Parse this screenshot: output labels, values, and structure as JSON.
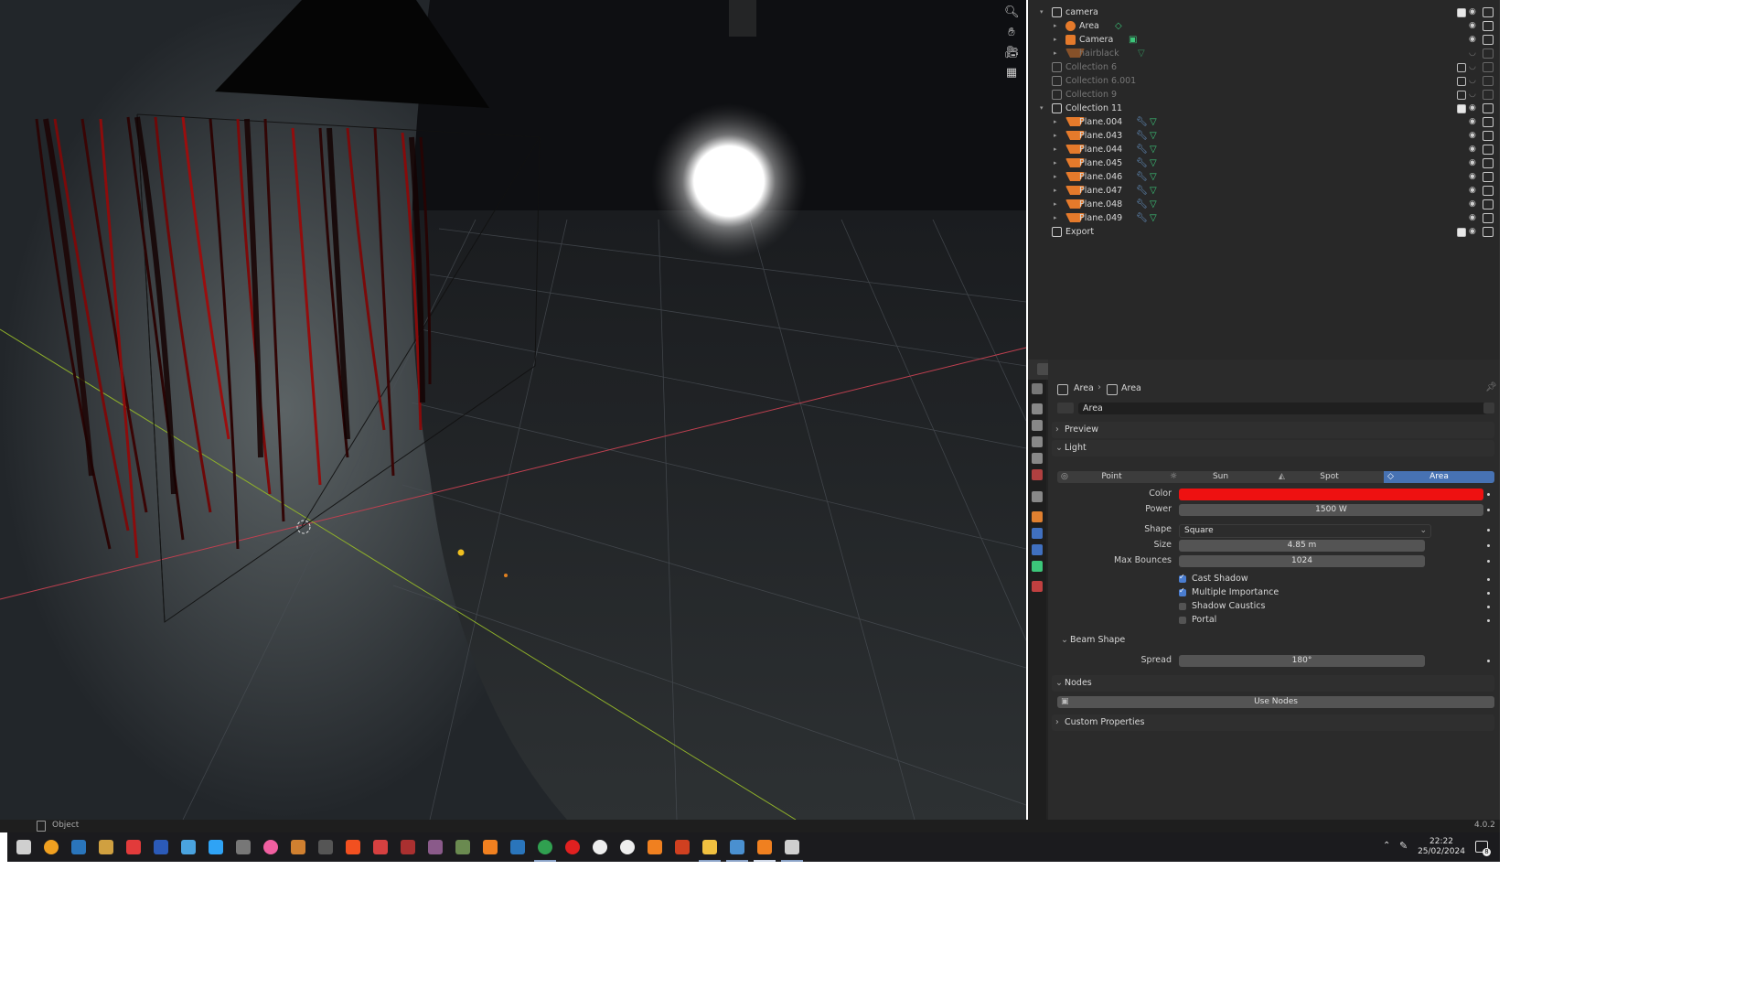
{
  "outliner": {
    "rows": [
      {
        "label": "camera",
        "kind": "collection",
        "dim": false,
        "expanded": true,
        "checked": true
      },
      {
        "label": "Area",
        "kind": "light",
        "dim": false
      },
      {
        "label": "Camera",
        "kind": "camera",
        "dim": false
      },
      {
        "label": "hairblack",
        "kind": "mesh",
        "dim": true
      },
      {
        "label": "Collection 6",
        "kind": "collection",
        "dim": true,
        "checked": false
      },
      {
        "label": "Collection 6.001",
        "kind": "collection",
        "dim": true,
        "checked": false
      },
      {
        "label": "Collection 9",
        "kind": "collection",
        "dim": true,
        "checked": false
      },
      {
        "label": "Collection 11",
        "kind": "collection",
        "dim": false,
        "expanded": true,
        "checked": true
      },
      {
        "label": "Plane.004",
        "kind": "mesh",
        "dim": false
      },
      {
        "label": "Plane.043",
        "kind": "mesh",
        "dim": false
      },
      {
        "label": "Plane.044",
        "kind": "mesh",
        "dim": false
      },
      {
        "label": "Plane.045",
        "kind": "mesh",
        "dim": false
      },
      {
        "label": "Plane.046",
        "kind": "mesh",
        "dim": false
      },
      {
        "label": "Plane.047",
        "kind": "mesh",
        "dim": false
      },
      {
        "label": "Plane.048",
        "kind": "mesh",
        "dim": false
      },
      {
        "label": "Plane.049",
        "kind": "mesh",
        "dim": false
      },
      {
        "label": "Export",
        "kind": "collection",
        "dim": false,
        "checked": true
      }
    ]
  },
  "properties": {
    "breadcrumb": [
      "Area",
      "Area"
    ],
    "datablock_name": "Area",
    "panels": {
      "preview": "Preview",
      "light": "Light",
      "beam_shape": "Beam Shape",
      "nodes": "Nodes",
      "custom": "Custom Properties"
    },
    "light_types": [
      "Point",
      "Sun",
      "Spot",
      "Area"
    ],
    "active_light_type": "Area",
    "color_label": "Color",
    "color_value": "#ee1111",
    "power_label": "Power",
    "power_value": "1500 W",
    "shape_label": "Shape",
    "shape_value": "Square",
    "size_label": "Size",
    "size_value": "4.85 m",
    "bounces_label": "Max Bounces",
    "bounces_value": "1024",
    "checkboxes": [
      {
        "label": "Cast Shadow",
        "checked": true
      },
      {
        "label": "Multiple Importance",
        "checked": true
      },
      {
        "label": "Shadow Caustics",
        "checked": false
      },
      {
        "label": "Portal",
        "checked": false
      }
    ],
    "spread_label": "Spread",
    "spread_value": "180°",
    "use_nodes_label": "Use Nodes"
  },
  "statusbar": {
    "mode": "Object",
    "version": "4.0.2"
  },
  "taskbar": {
    "time": "22:22",
    "date": "25/02/2024",
    "notifications": "8"
  },
  "colors": {
    "accent": "#4772b3",
    "light_color": "#ee1111"
  }
}
